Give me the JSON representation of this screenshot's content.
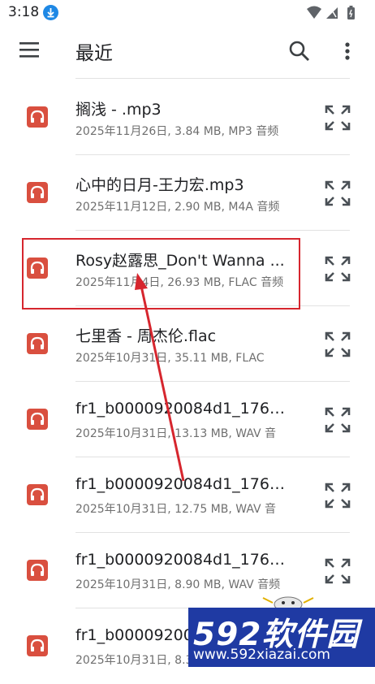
{
  "status_bar": {
    "time": "3:18"
  },
  "toolbar": {
    "title": "最近"
  },
  "files": [
    {
      "name": "搁浅 - .mp3",
      "meta": "2025年11月26日, 3.84 MB, MP3 音频"
    },
    {
      "name": "心中的日月-王力宏.mp3",
      "meta": "2025年11月12日, 2.90 MB, M4A 音频"
    },
    {
      "name": "Rosy赵露思_Don't Wanna ...",
      "meta": "2025年11月4日, 26.93 MB, FLAC 音频"
    },
    {
      "name": "七里香 - 周杰伦.flac",
      "meta": "2025年10月31日, 35.11 MB, FLAC"
    },
    {
      "name": "fr1_b0000920084d1_1761...",
      "meta": "2025年10月31日, 13.13 MB, WAV 音"
    },
    {
      "name": "fr1_b0000920084d1_1761...",
      "meta": "2025年10月31日, 12.75 MB, WAV 音"
    },
    {
      "name": "fr1_b0000920084d1_1761...",
      "meta": "2025年10月31日, 8.90 MB, WAV 音频"
    },
    {
      "name": "fr1_b00009200",
      "meta": "2025年10月31日, 8.3"
    }
  ],
  "watermark": {
    "logo": "592软件园",
    "url": "www.592xiazai.com"
  },
  "colors": {
    "file_icon": "#d94f3f",
    "annotation": "#d6262e",
    "watermark_bg": "#1f3aa3"
  }
}
